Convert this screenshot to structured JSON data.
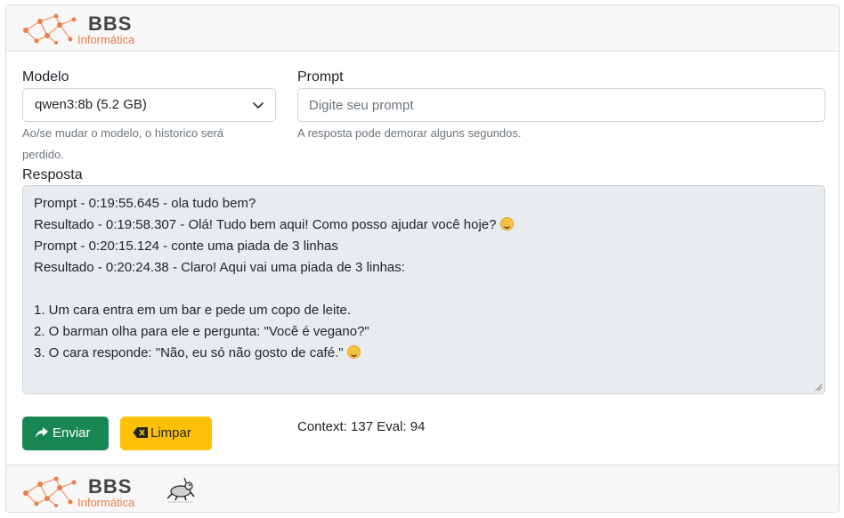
{
  "brand": {
    "name": "BBS",
    "sub": "Informática",
    "accent": "#ef7d4a"
  },
  "model": {
    "label": "Modelo",
    "selected": "qwen3:8b (5.2 GB)",
    "help_line1": "Ao/se mudar o modelo, o historico será",
    "help_line2": "perdido."
  },
  "prompt": {
    "label": "Prompt",
    "placeholder": "Digite seu prompt",
    "value": "",
    "help": "A resposta pode demorar alguns segundos."
  },
  "response": {
    "label": "Resposta",
    "lines": [
      "Prompt - 0:19:55.645 - ola tudo bem?",
      "Resultado - 0:19:58.307 - Olá! Tudo bem aqui! Como posso ajudar você hoje?",
      "Prompt - 0:20:15.124 - conte uma piada de 3 linhas",
      "Resultado - 0:20:24.38 - Claro! Aqui vai uma piada de 3 linhas:",
      "",
      "1. Um cara entra em um bar e pede um copo de leite.",
      "2. O barman olha para ele e pergunta: \"Você é vegano?\"",
      "3. O cara responde: \"Não, eu só não gosto de café.\""
    ],
    "background": "#e9ecef"
  },
  "buttons": {
    "send": {
      "label": "Enviar",
      "icon": "share-arrow-icon",
      "color": "#198754"
    },
    "clear": {
      "label": "Limpar",
      "icon": "backspace-icon",
      "color": "#ffc107"
    }
  },
  "stats": {
    "text": "Context: 137 Eval: 94"
  }
}
